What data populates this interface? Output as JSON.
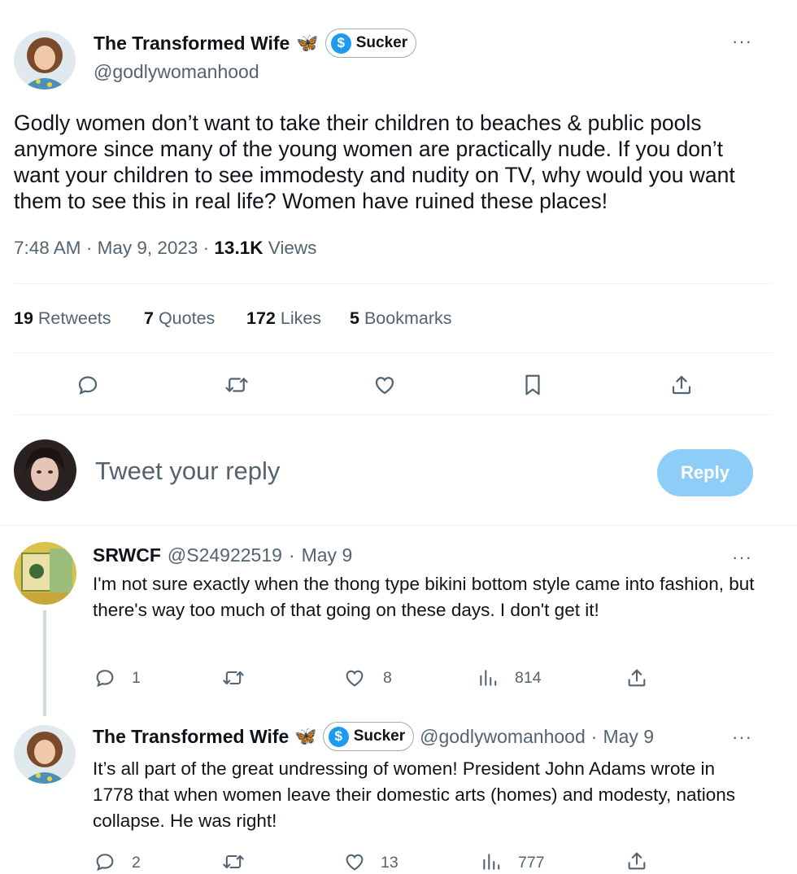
{
  "main_tweet": {
    "author_name": "The Transformed Wife",
    "butterfly": "🦋",
    "badge_label": "Sucker",
    "badge_symbol": "$",
    "handle": "@godlywomanhood",
    "text": "Godly women don’t want to take their children to beaches & public pools anymore since many of the young women are practically nude. If you don’t want your children to see immodesty and nudity on TV, why would you want them to see this in real life? Women have ruined these places!",
    "time": "7:48 AM",
    "date": "May 9, 2023",
    "views_count": "13.1K",
    "views_label": "Views",
    "more": "···"
  },
  "stats": [
    {
      "count": "19",
      "label": "Retweets"
    },
    {
      "count": "7",
      "label": "Quotes"
    },
    {
      "count": "172",
      "label": "Likes"
    },
    {
      "count": "5",
      "label": "Bookmarks"
    }
  ],
  "action_icons": [
    "reply-icon",
    "retweet-icon",
    "like-icon",
    "bookmark-icon",
    "share-icon"
  ],
  "compose": {
    "placeholder": "Tweet your reply",
    "button_label": "Reply"
  },
  "replies": [
    {
      "author_name": "SRWCF",
      "handle": "@S24922519",
      "date": "May 9",
      "text": "I'm not sure exactly when the thong type bikini bottom style came into fashion, but there's way too much of that going on these days.  I don't get it!",
      "replies": "1",
      "retweets": "",
      "likes": "8",
      "views": "814",
      "more": "···"
    },
    {
      "author_name": "The Transformed Wife",
      "butterfly": "🦋",
      "badge_label": "Sucker",
      "badge_symbol": "$",
      "handle": "@godlywomanhood",
      "date": "May 9",
      "text": "It’s all part of the great undressing of women! President John Adams wrote in 1778 that when women leave their domestic arts (homes) and modesty, nations collapse. He was right!",
      "replies": "2",
      "retweets": "",
      "likes": "13",
      "views": "777",
      "more": "···"
    }
  ],
  "colors": {
    "text": "#0f1419",
    "muted": "#536471",
    "accent": "#1d9bf0",
    "reply_button_disabled": "#8ecdf8",
    "divider": "#eff3f4",
    "thread_line": "#cfd9de"
  }
}
